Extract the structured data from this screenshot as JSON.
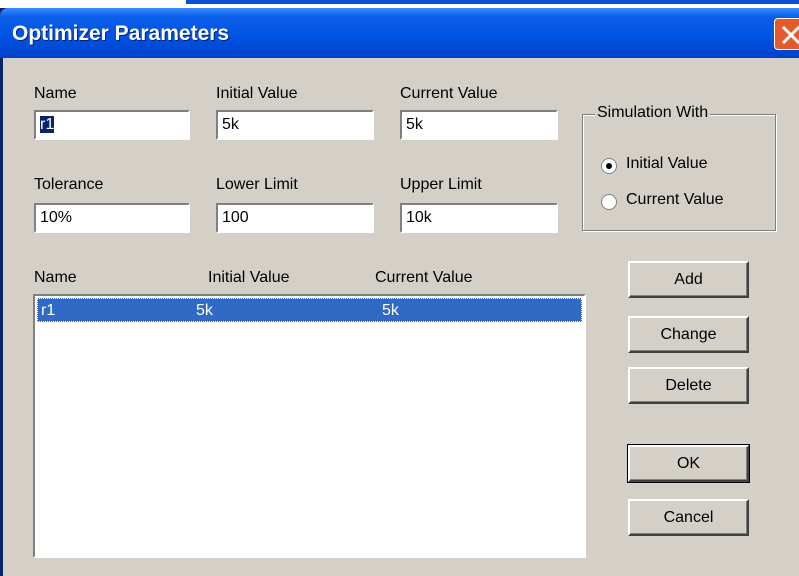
{
  "window": {
    "title": "Optimizer Parameters"
  },
  "fields": {
    "name_label": "Name",
    "name_value": "r1",
    "initial_label": "Initial Value",
    "initial_value": "5k",
    "current_label": "Current Value",
    "current_value": "5k",
    "tolerance_label": "Tolerance",
    "tolerance_value": "10%",
    "lower_label": "Lower Limit",
    "lower_value": "100",
    "upper_label": "Upper Limit",
    "upper_value": "10k"
  },
  "simulation": {
    "title": "Simulation With",
    "options": [
      {
        "label": "Initial Value",
        "selected": true
      },
      {
        "label": "Current Value",
        "selected": false
      }
    ]
  },
  "list": {
    "headers": [
      "Name",
      "Initial Value",
      "Current Value"
    ],
    "rows": [
      {
        "name": "r1",
        "initial": "5k",
        "current": "5k",
        "selected": true
      }
    ]
  },
  "buttons": {
    "add": "Add",
    "change": "Change",
    "delete": "Delete",
    "ok": "OK",
    "cancel": "Cancel"
  }
}
